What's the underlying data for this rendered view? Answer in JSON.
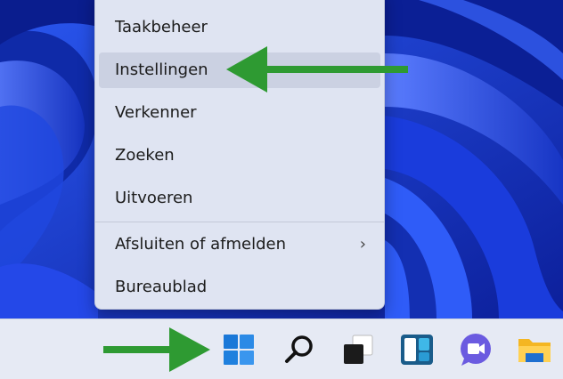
{
  "context_menu": {
    "items": [
      {
        "label": "Taakbeheer"
      },
      {
        "label": "Instellingen"
      },
      {
        "label": "Verkenner"
      },
      {
        "label": "Zoeken"
      },
      {
        "label": "Uitvoeren"
      },
      {
        "label": "Afsluiten of afmelden"
      },
      {
        "label": "Bureaublad"
      }
    ],
    "submenu_chevron": "›"
  },
  "taskbar": {
    "icons": [
      "windows-start-icon",
      "search-icon",
      "task-view-icon",
      "widgets-icon",
      "teams-chat-icon",
      "file-explorer-icon"
    ]
  },
  "colors": {
    "annotation_arrow": "#2e9a32",
    "wallpaper_blue": "#1638c8",
    "menu_bg": "#dfe4f2",
    "taskbar_bg": "#e6eaf4"
  }
}
